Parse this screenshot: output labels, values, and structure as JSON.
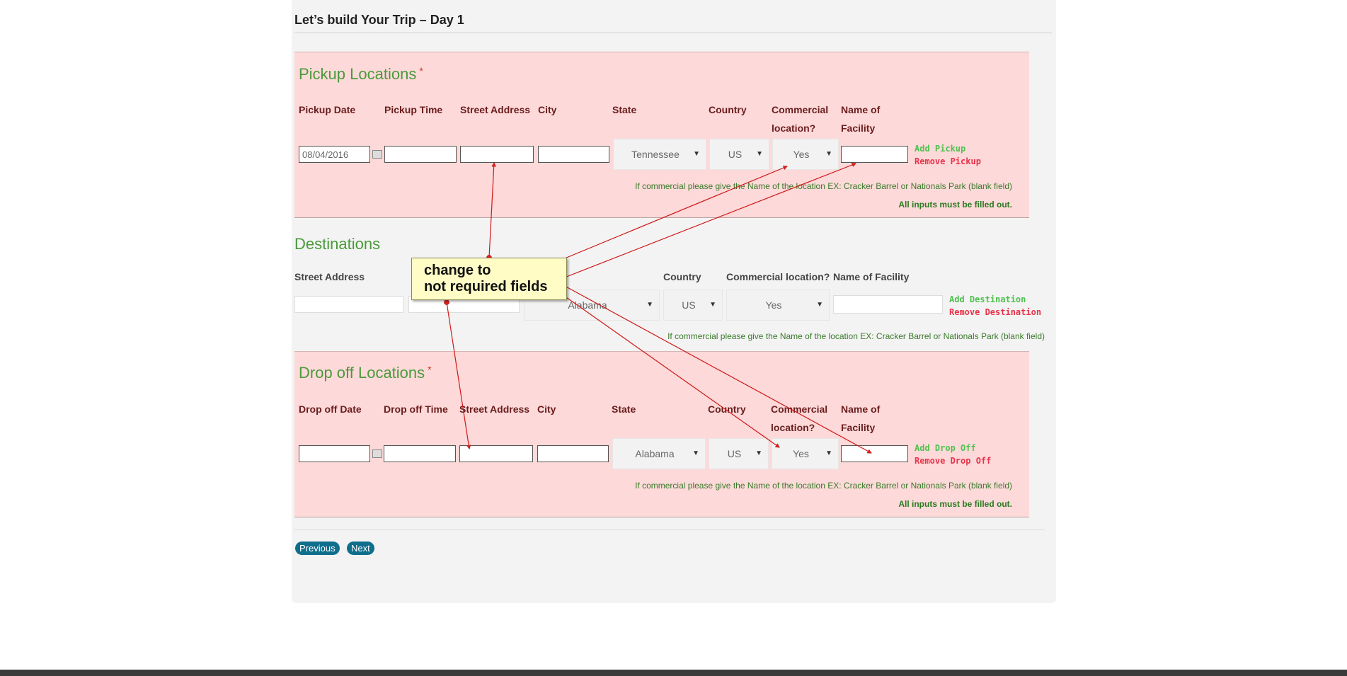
{
  "page_title": "Let’s build Your Trip – Day 1",
  "pickup": {
    "title": "Pickup Locations",
    "required_mark": "*",
    "columns": [
      "Pickup Date",
      "Pickup Time",
      "Street Address",
      "City",
      "State",
      "Country",
      "Commercial location?",
      "Name of Facility"
    ],
    "date_value": "08/04/2016",
    "state_value": "Tennessee",
    "country_value": "US",
    "commercial_value": "Yes",
    "add_label": "Add Pickup",
    "remove_label": "Remove Pickup",
    "hint": "If commercial please give the Name of the location EX: Cracker Barrel or Nationals Park (blank field)",
    "required_note": "All inputs must be filled out."
  },
  "destinations": {
    "title": "Destinations",
    "columns": [
      "Street Address",
      "Country",
      "Commercial location?",
      "Name of Facility"
    ],
    "state_value": "Alabama",
    "country_value": "US",
    "commercial_value": "Yes",
    "add_label": "Add Destination",
    "remove_label": "Remove Destination",
    "hint": "If commercial please give the Name of the location EX: Cracker Barrel or Nationals Park (blank field)"
  },
  "dropoff": {
    "title": "Drop off Locations",
    "required_mark": "*",
    "columns": [
      "Drop off Date",
      "Drop off Time",
      "Street Address",
      "City",
      "State",
      "Country",
      "Commercial location?",
      "Name of Facility"
    ],
    "state_value": "Alabama",
    "country_value": "US",
    "commercial_value": "Yes",
    "add_label": "Add Drop Off",
    "remove_label": "Remove Drop Off",
    "hint": "If commercial please give the Name of the location EX: Cracker Barrel or Nationals Park (blank field)",
    "required_note": "All inputs must be filled out."
  },
  "nav": {
    "previous_label": "Previous",
    "next_label": "Next"
  },
  "annotation": {
    "line1": "change to",
    "line2": "not required fields",
    "color": "#e02020"
  },
  "colors": {
    "section_bg": "#fdd9d9",
    "heading_green": "#4a9a3a",
    "label_maroon": "#6a1d1d",
    "button_blue": "#0f6e8c"
  }
}
